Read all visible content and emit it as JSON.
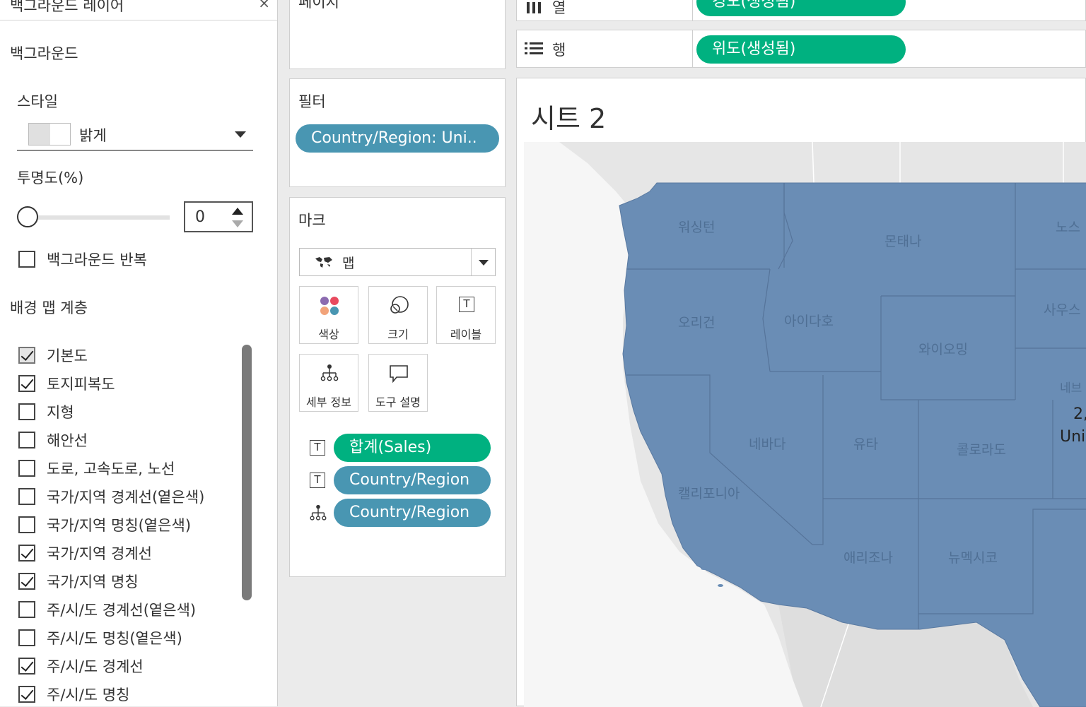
{
  "left_panel": {
    "header_title": "백그라운드 레이어",
    "close_glyph": "×",
    "background_section": "백그라운드",
    "style_label": "스타일",
    "style_value": "밝게",
    "opacity_label": "투명도(%)",
    "opacity_value": "0",
    "opacity_fraction": 0,
    "repeat_label": "백그라운드 반복",
    "layers_section": "배경 맵 계층",
    "layers": [
      {
        "label": "기본도",
        "checked": true,
        "disabled": true
      },
      {
        "label": "토지피복도",
        "checked": true
      },
      {
        "label": "지형",
        "checked": false
      },
      {
        "label": "해안선",
        "checked": false
      },
      {
        "label": "도로, 고속도로, 노선",
        "checked": false
      },
      {
        "label": "국가/지역 경계선(옅은색)",
        "checked": false
      },
      {
        "label": "국가/지역 명칭(옅은색)",
        "checked": false
      },
      {
        "label": "국가/지역 경계선",
        "checked": true
      },
      {
        "label": "국가/지역 명칭",
        "checked": true
      },
      {
        "label": "주/시/도 경계선(옅은색)",
        "checked": false
      },
      {
        "label": "주/시/도 명칭(옅은색)",
        "checked": false
      },
      {
        "label": "주/시/도 경계선",
        "checked": true
      },
      {
        "label": "주/시/도 명칭",
        "checked": true
      }
    ]
  },
  "pages_card": {
    "title": "페이지"
  },
  "filters_card": {
    "title": "필터",
    "pill": "Country/Region: Uni.."
  },
  "marks_card": {
    "title": "마크",
    "mark_type": "맵",
    "buttons": {
      "color": "색상",
      "size": "크기",
      "label": "레이블",
      "detail": "세부 정보",
      "tooltip": "도구 설명"
    },
    "fields": [
      {
        "icon": "T",
        "label": "합계(Sales)",
        "color": "green"
      },
      {
        "icon": "T",
        "label": "Country/Region",
        "color": "blue"
      },
      {
        "icon": "detail",
        "label": "Country/Region",
        "color": "blue"
      }
    ]
  },
  "shelves": {
    "columns_label": "열",
    "columns_pill": "경도(생성됨)",
    "rows_label": "행",
    "rows_pill": "위도(생성됨)"
  },
  "view": {
    "sheet_title": "시트 2",
    "map_label_value": "2,",
    "map_label_country": "Uni",
    "states": [
      "워싱턴",
      "몬태나",
      "노스",
      "오리건",
      "아이다호",
      "와이오밍",
      "사우스",
      "네브",
      "네바다",
      "유타",
      "콜로라도",
      "캘리포니아",
      "애리조나",
      "뉴멕시코"
    ]
  },
  "colors": {
    "map_fill": "#6a8db5",
    "pill_blue": "#4996b2",
    "pill_green": "#00b180"
  }
}
